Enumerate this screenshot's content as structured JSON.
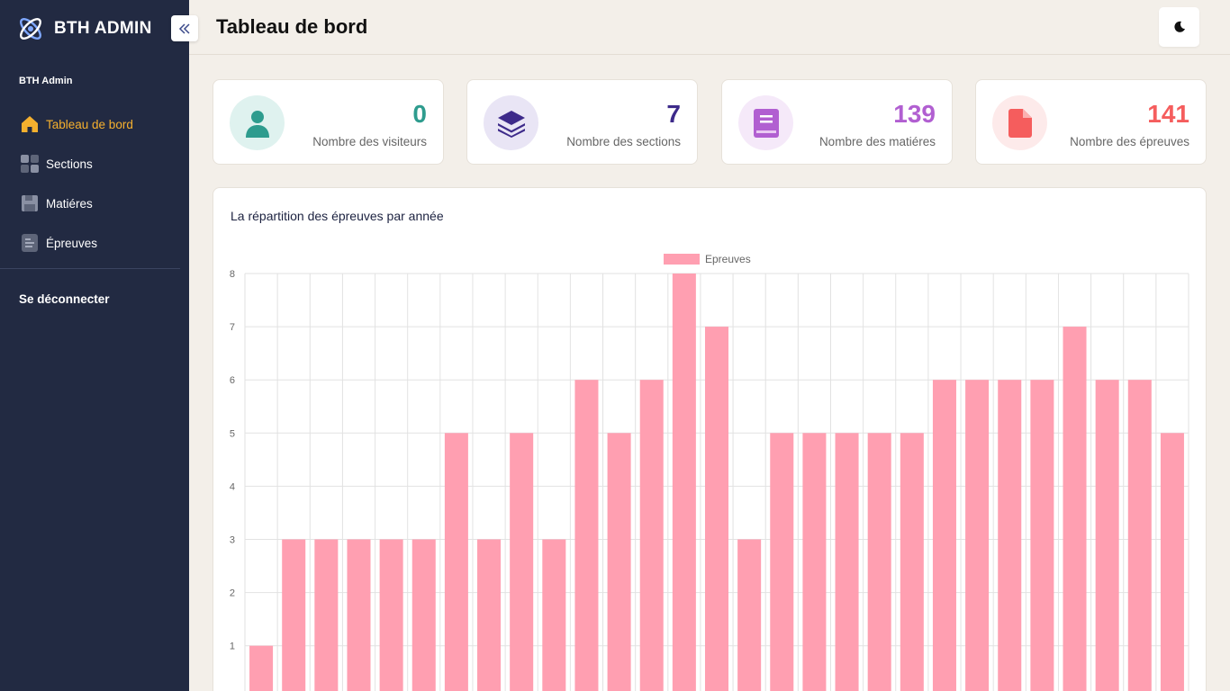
{
  "sidebar": {
    "brand": "BTH ADMIN",
    "section_label": "BTH Admin",
    "items": [
      {
        "label": "Tableau de bord",
        "icon": "home-icon",
        "active": true
      },
      {
        "label": "Sections",
        "icon": "grid-icon",
        "active": false
      },
      {
        "label": "Matiéres",
        "icon": "save-icon",
        "active": false
      },
      {
        "label": "Épreuves",
        "icon": "document-icon",
        "active": false
      }
    ],
    "logout": "Se déconnecter"
  },
  "header": {
    "title": "Tableau de bord",
    "theme_icon": "moon-icon"
  },
  "stats": [
    {
      "value": "0",
      "caption": "Nombre des visiteurs",
      "color": "#2e9c8e",
      "bg": "#dff2ef",
      "icon": "user-icon"
    },
    {
      "value": "7",
      "caption": "Nombre des sections",
      "color": "#3d2a8a",
      "bg": "#e9e5f5",
      "icon": "layers-icon"
    },
    {
      "value": "139",
      "caption": "Nombre des matiéres",
      "color": "#b15fd1",
      "bg": "#f5e9f9",
      "icon": "book-icon"
    },
    {
      "value": "141",
      "caption": "Nombre des épreuves",
      "color": "#f55d5d",
      "bg": "#fdeaea",
      "icon": "file-icon"
    }
  ],
  "chart_card": {
    "title": "La répartition des épreuves par année"
  },
  "chart_data": {
    "type": "bar",
    "series": [
      {
        "name": "Epreuves",
        "values": [
          1,
          3,
          3,
          3,
          3,
          3,
          5,
          3,
          5,
          3,
          6,
          5,
          6,
          8,
          7,
          3,
          5,
          5,
          5,
          5,
          5,
          6,
          6,
          6,
          6,
          7,
          6,
          6,
          5
        ]
      }
    ],
    "ylim": [
      0,
      8
    ],
    "yticks": [
      1,
      2,
      3,
      4,
      5,
      6,
      7,
      8
    ],
    "grid": true,
    "legend": "top-center",
    "color": "#ff9fb1"
  }
}
